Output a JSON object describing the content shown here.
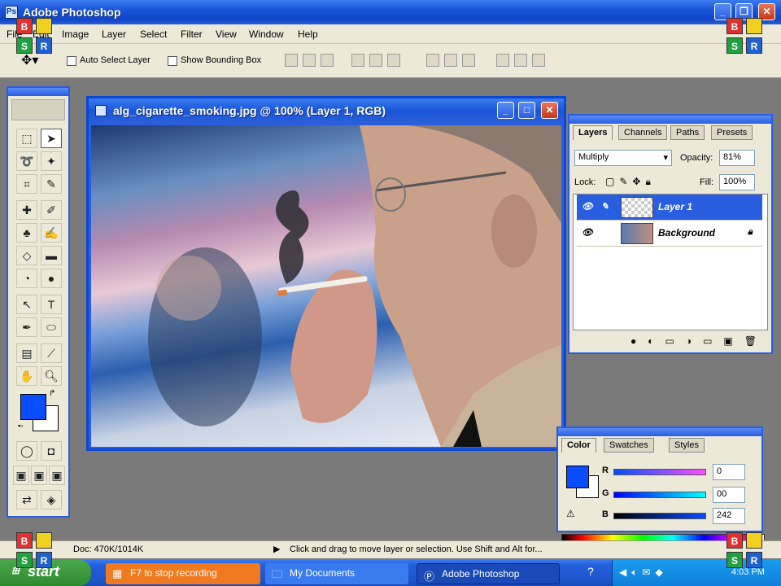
{
  "app": {
    "title": "Adobe Photoshop",
    "icon": "photoshop-icon"
  },
  "menu": [
    "File",
    "Edit",
    "Image",
    "Layer",
    "Select",
    "Filter",
    "View",
    "Window",
    "Help"
  ],
  "options": {
    "auto_select_layer": "Auto Select Layer",
    "show_bounding_box": "Show Bounding Box"
  },
  "document": {
    "title": "alg_cigarette_smoking.jpg @ 100% (Layer 1, RGB)"
  },
  "layers_palette": {
    "tabs": [
      "Layers",
      "Channels",
      "Paths",
      "Presets"
    ],
    "blend_mode": "Multiply",
    "opacity_label": "Opacity:",
    "opacity_value": "81%",
    "lock_label": "Lock:",
    "fill_label": "Fill:",
    "fill_value": "100%",
    "layers": [
      {
        "name": "Layer 1",
        "selected": true
      },
      {
        "name": "Background",
        "selected": false
      }
    ]
  },
  "color_palette": {
    "tabs": [
      "Color",
      "Swatches",
      "Styles"
    ],
    "channels": [
      {
        "label": "R",
        "value": "0"
      },
      {
        "label": "G",
        "value": "00"
      },
      {
        "label": "B",
        "value": "242"
      }
    ],
    "foreground": "#0a4cff",
    "background": "#ffffff"
  },
  "status": {
    "doc": "Doc: 470K/1014K",
    "hint": "Click and drag to move layer or selection. Use Shift and Alt for..."
  },
  "taskbar": {
    "start": "start",
    "tasks": [
      {
        "label": "F7 to stop recording",
        "color": "#f07a20"
      },
      {
        "label": "My Documents",
        "color": "#3a7bf0"
      },
      {
        "label": "Adobe Photoshop",
        "color": "#1a4ab8"
      }
    ],
    "clock": "4:03 PM"
  },
  "recorder": {
    "labels": [
      "B",
      "R",
      "S",
      "R"
    ]
  }
}
